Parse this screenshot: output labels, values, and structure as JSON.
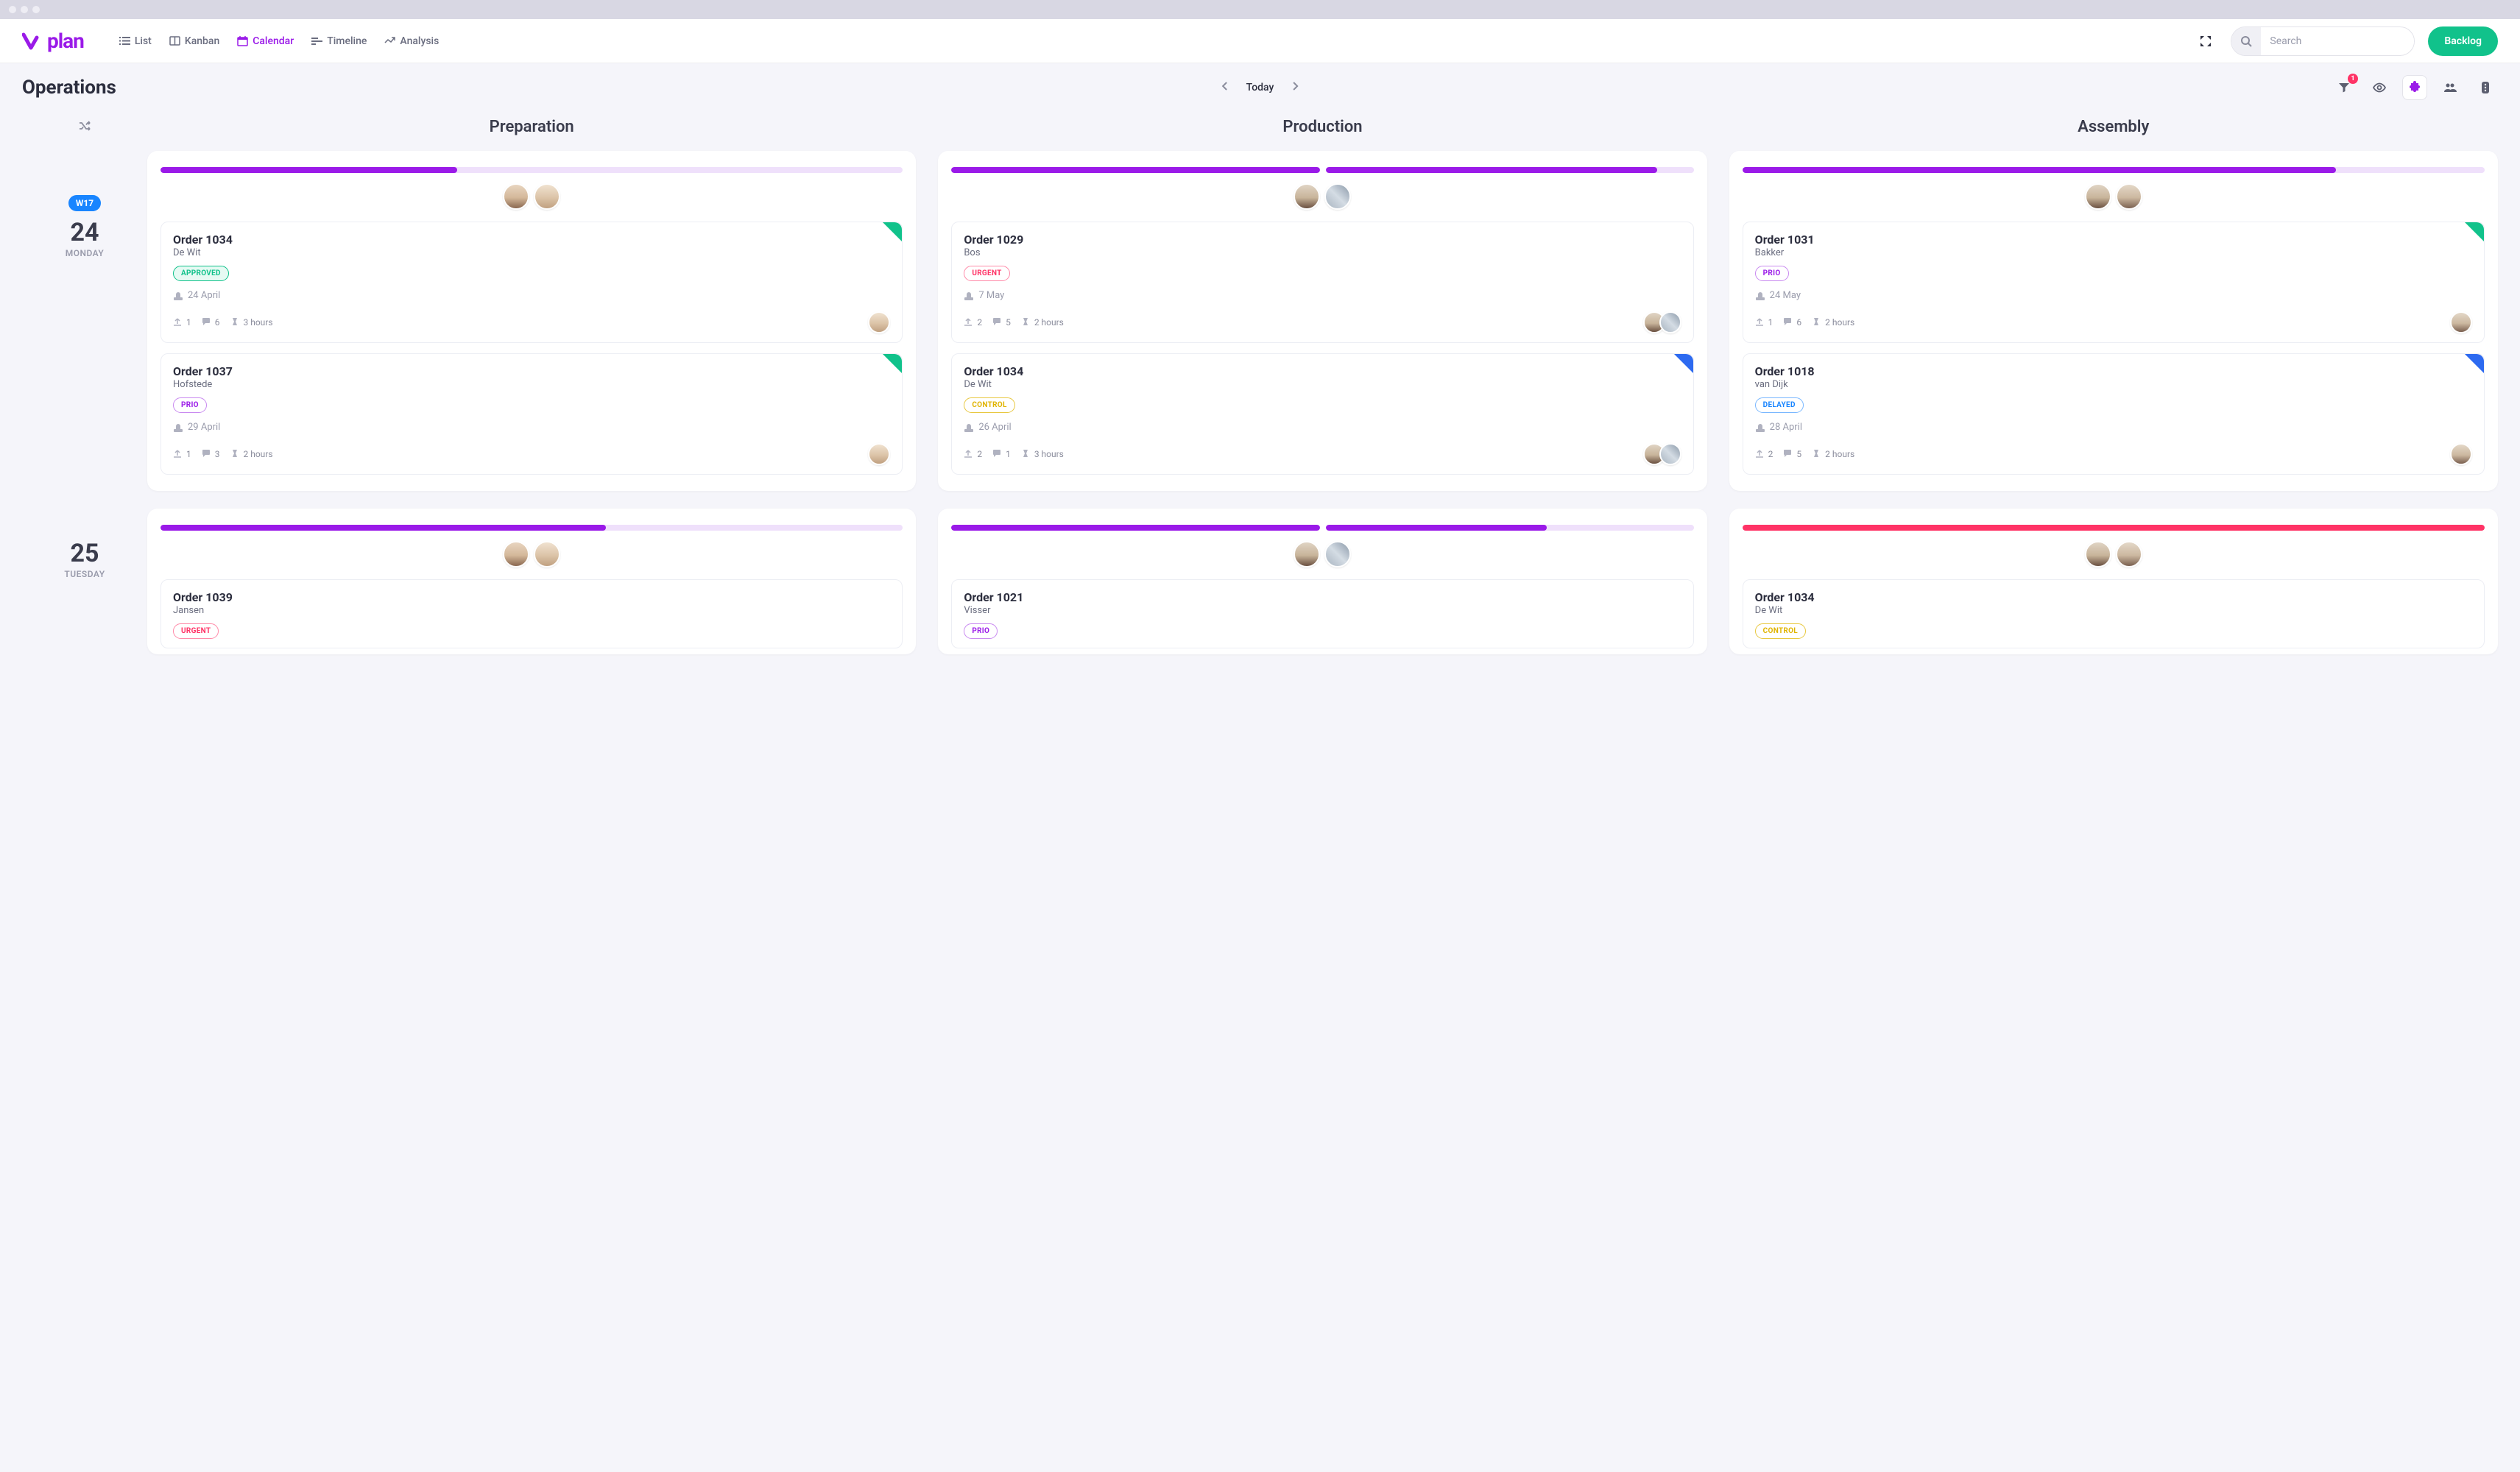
{
  "nav": {
    "list": "List",
    "kanban": "Kanban",
    "calendar": "Calendar",
    "timeline": "Timeline",
    "analysis": "Analysis"
  },
  "search": {
    "placeholder": "Search"
  },
  "backlog_label": "Backlog",
  "page_title": "Operations",
  "date_nav": {
    "today": "Today"
  },
  "filter_badge": "1",
  "columns": {
    "preparation": "Preparation",
    "production": "Production",
    "assembly": "Assembly"
  },
  "days": {
    "d1": {
      "week": "W17",
      "num": "24",
      "name": "MONDAY"
    },
    "d2": {
      "num": "25",
      "name": "TUESDAY"
    }
  },
  "cards": {
    "prep_d1_a": {
      "title": "Order 1034",
      "sub": "De Wit",
      "tag": "APPROVED",
      "date": "24 April",
      "up": "1",
      "comments": "6",
      "hours": "3 hours"
    },
    "prep_d1_b": {
      "title": "Order 1037",
      "sub": "Hofstede",
      "tag": "PRIO",
      "date": "29 April",
      "up": "1",
      "comments": "3",
      "hours": "2 hours"
    },
    "prep_d2_a": {
      "title": "Order 1039",
      "sub": "Jansen",
      "tag": "URGENT"
    },
    "prod_d1_a": {
      "title": "Order 1029",
      "sub": "Bos",
      "tag": "URGENT",
      "date": "7 May",
      "up": "2",
      "comments": "5",
      "hours": "2 hours"
    },
    "prod_d1_b": {
      "title": "Order 1034",
      "sub": "De Wit",
      "tag": "CONTROL",
      "date": "26 April",
      "up": "2",
      "comments": "1",
      "hours": "3 hours"
    },
    "prod_d2_a": {
      "title": "Order 1021",
      "sub": "Visser",
      "tag": "PRIO"
    },
    "asm_d1_a": {
      "title": "Order 1031",
      "sub": "Bakker",
      "tag": "PRIO",
      "date": "24 May",
      "up": "1",
      "comments": "6",
      "hours": "2 hours"
    },
    "asm_d1_b": {
      "title": "Order 1018",
      "sub": "van Dijk",
      "tag": "DELAYED",
      "date": "28 April",
      "up": "2",
      "comments": "5",
      "hours": "2 hours"
    },
    "asm_d2_a": {
      "title": "Order 1034",
      "sub": "De Wit",
      "tag": "CONTROL"
    }
  }
}
